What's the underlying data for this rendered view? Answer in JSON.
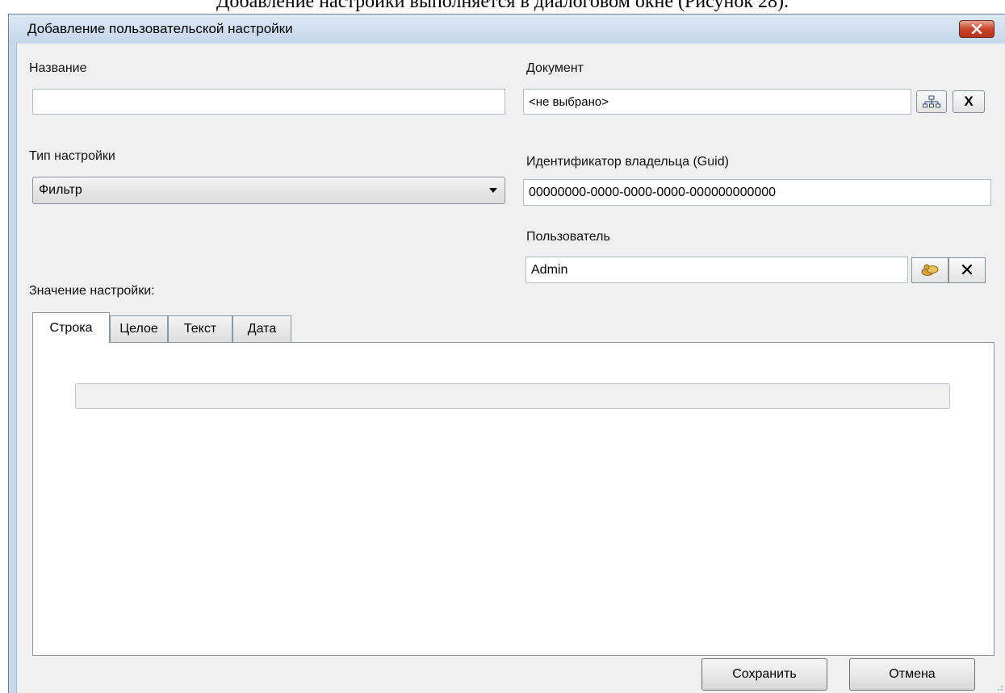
{
  "document_caption": "Добавление настройки выполняется в диалоговом окне (Рисунок 28).",
  "dialog": {
    "title": "Добавление пользовательской настройки",
    "close_icon": "close-x-icon"
  },
  "fields": {
    "name": {
      "label": "Название",
      "value": ""
    },
    "document": {
      "label": "Документ",
      "value": "<не выбрано>",
      "select_icon": "tree-structure-icon",
      "clear_label": "X"
    },
    "setting_type": {
      "label": "Тип настройки",
      "value": "Фильтр"
    },
    "owner_id": {
      "label": "Идентификатор владельца (Guid)",
      "value": "00000000-0000-0000-0000-000000000000"
    },
    "user": {
      "label": "Пользователь",
      "value": "Admin",
      "select_icon": "users-icon",
      "clear_label": "✕"
    }
  },
  "setting_value": {
    "label": "Значение настройки:",
    "tabs": [
      "Строка",
      "Целое",
      "Текст",
      "Дата"
    ],
    "active_tab": "Строка",
    "value": ""
  },
  "buttons": {
    "save": "Сохранить",
    "cancel": "Отмена"
  }
}
